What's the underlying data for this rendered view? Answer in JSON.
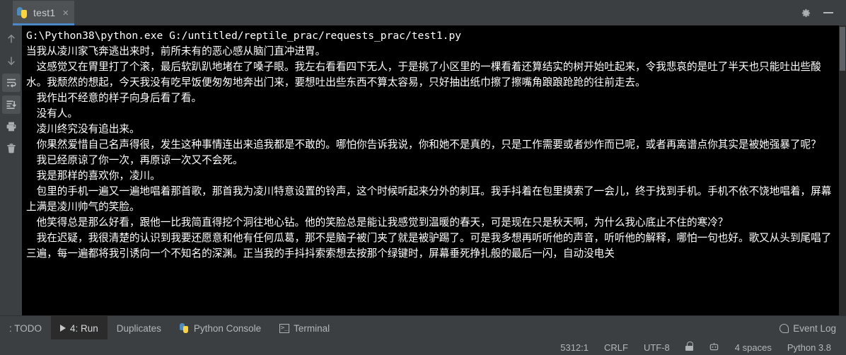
{
  "window": {
    "tab": {
      "label": "test1",
      "icon": "python-file-icon",
      "close": "×"
    },
    "settings_icon": "gear-icon",
    "minimize_icon": "minimize-icon"
  },
  "left_toolbar": {
    "items": [
      {
        "name": "up-arrow-icon",
        "tooltip": "Up the Stack Trace",
        "selected": false
      },
      {
        "name": "down-arrow-icon",
        "tooltip": "Down the Stack Trace",
        "selected": false
      },
      {
        "name": "soft-wrap-icon",
        "tooltip": "Soft-Wrap",
        "selected": true
      },
      {
        "name": "scroll-to-end-icon",
        "tooltip": "Scroll to End",
        "selected": true
      },
      {
        "name": "print-icon",
        "tooltip": "Print",
        "selected": false
      },
      {
        "name": "trash-icon",
        "tooltip": "Clear All",
        "selected": false
      }
    ]
  },
  "console": {
    "command": "G:\\Python38\\python.exe G:/untitled/reptile_prac/requests_prac/test1.py",
    "lines": [
      "当我从凌川家飞奔逃出来时，前所未有的恶心感从脑门直冲进胃。",
      "　这感觉又在胃里打了个滚，最后软趴趴地堵在了嗓子眼。我左右看看四下无人，于是挑了小区里的一棵看着还算结实的树开始吐起来，令我悲哀的是吐了半天也只能吐出些酸水。我颓然的想起，今天我没有吃早饭便匆匆地奔出门来，要想吐出些东西不算太容易，只好抽出纸巾擦了擦嘴角踉踉跄跄的往前走去。",
      "　我作出不经意的样子向身后看了看。",
      "　没有人。",
      "　凌川终究没有追出来。",
      "　你果然爱惜自己名声得很，发生这种事情连出来追我都是不敢的。哪怕你告诉我说，你和她不是真的，只是工作需要或者炒作而已呢，或者再离谱点你其实是被她强暴了呢？",
      "　我已经原谅了你一次，再原谅一次又不会死。",
      "　我是那样的喜欢你，凌川。",
      "　包里的手机一遍又一遍地唱着那首歌，那首我为凌川特意设置的铃声，这个时候听起来分外的刺耳。我手抖着在包里摸索了一会儿，终于找到手机。手机不依不饶地唱着，屏幕上满是凌川帅气的笑脸。",
      "　他笑得总是那么好看，跟他一比我简直得挖个洞往地心钻。他的笑脸总是能让我感觉到温暖的春天，可是现在只是秋天啊，为什么我心底止不住的寒冷？",
      "　我在迟疑，我很清楚的认识到我要还愿意和他有任何瓜葛，那不是脑子被门夹了就是被驴踢了。可是我多想再听听他的声音，听听他的解释，哪怕一句也好。歌又从头到尾唱了三遍，每一遍都将我引诱向一个不知名的深渊。正当我的手抖抖索索想去按那个绿键时，屏幕垂死挣扎般的最后一闪，自动没电关"
    ]
  },
  "bottom_bar": {
    "tabs": [
      {
        "label": ": TODO",
        "icon": null,
        "active": false
      },
      {
        "label": "4: Run",
        "icon": "play-icon",
        "active": true,
        "num": "4"
      },
      {
        "label": "Duplicates",
        "icon": null,
        "active": false
      },
      {
        "label": "Python Console",
        "icon": "python-icon",
        "active": false
      },
      {
        "label": "Terminal",
        "icon": "terminal-icon",
        "active": false
      }
    ],
    "event_log": {
      "label": "Event Log",
      "icon": "event-log-icon"
    }
  },
  "status_bar": {
    "caret": "5312:1",
    "line_separator": "CRLF",
    "encoding": "UTF-8",
    "lock": "unlocked-icon",
    "inspection": "inspection-icon",
    "indent": "4 spaces",
    "interpreter": "Python 3.8"
  },
  "colors": {
    "chrome": "#3c3f41",
    "console_bg": "#000000",
    "console_fg": "#ffffff",
    "accent": "#4a88c7",
    "tab_active": "#4e5254"
  }
}
